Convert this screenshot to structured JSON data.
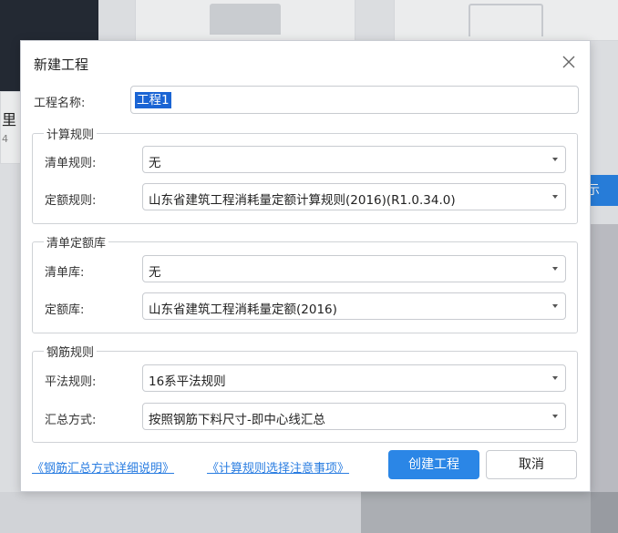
{
  "background": {
    "left_text_1": "里",
    "left_text_2": "4",
    "blue_button_text": "示"
  },
  "dialog": {
    "title": "新建工程",
    "project_name_label": "工程名称:",
    "project_name_value": "工程1",
    "groups": {
      "calc_rules": {
        "title": "计算规则",
        "list_rule_label": "清单规则:",
        "list_rule_value": "无",
        "quota_rule_label": "定额规则:",
        "quota_rule_value": "山东省建筑工程消耗量定额计算规则(2016)(R1.0.34.0)"
      },
      "list_quota_lib": {
        "title": "清单定额库",
        "list_lib_label": "清单库:",
        "list_lib_value": "无",
        "quota_lib_label": "定额库:",
        "quota_lib_value": "山东省建筑工程消耗量定额(2016)"
      },
      "rebar_rules": {
        "title": "钢筋规则",
        "flat_rule_label": "平法规则:",
        "flat_rule_value": "16系平法规则",
        "summary_label": "汇总方式:",
        "summary_value": "按照钢筋下料尺寸-即中心线汇总"
      }
    },
    "links": {
      "rebar_summary_help": "《钢筋汇总方式详细说明》",
      "calc_rule_notes": "《计算规则选择注意事项》"
    },
    "buttons": {
      "create": "创建工程",
      "cancel": "取消"
    }
  }
}
